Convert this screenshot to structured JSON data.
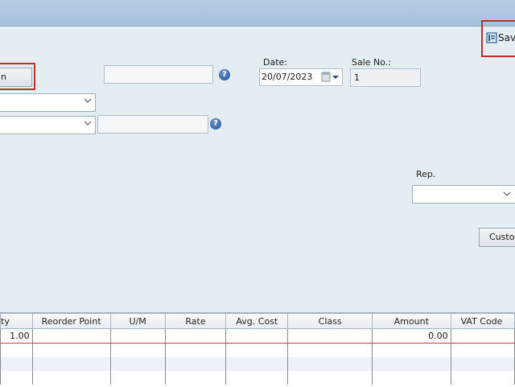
{
  "toolbar": {
    "save_label": "Sav"
  },
  "form": {
    "left_button_label": "n",
    "date": {
      "label": "Date:",
      "value": "20/07/2023"
    },
    "sale_no": {
      "label": "Sale No.:",
      "value": "1"
    },
    "rep": {
      "label": "Rep.",
      "value": ""
    },
    "customer_button_label": "Custo",
    "help_glyph": "?"
  },
  "grid": {
    "columns": [
      "ty",
      "Reorder Point",
      "U/M",
      "Rate",
      "Avg. Cost",
      "Class",
      "Amount",
      "VAT Code"
    ],
    "rows": [
      [
        "1.00",
        "",
        "",
        "",
        "",
        "",
        "0.00",
        ""
      ],
      [
        "",
        "",
        "",
        "",
        "",
        "",
        "",
        ""
      ],
      [
        "",
        "",
        "",
        "",
        "",
        "",
        "",
        ""
      ],
      [
        "",
        "",
        "",
        "",
        "",
        "",
        "",
        ""
      ]
    ]
  },
  "colors": {
    "highlight": "#c42b2b",
    "active_row": "#d94040",
    "background": "#e4eef2"
  }
}
